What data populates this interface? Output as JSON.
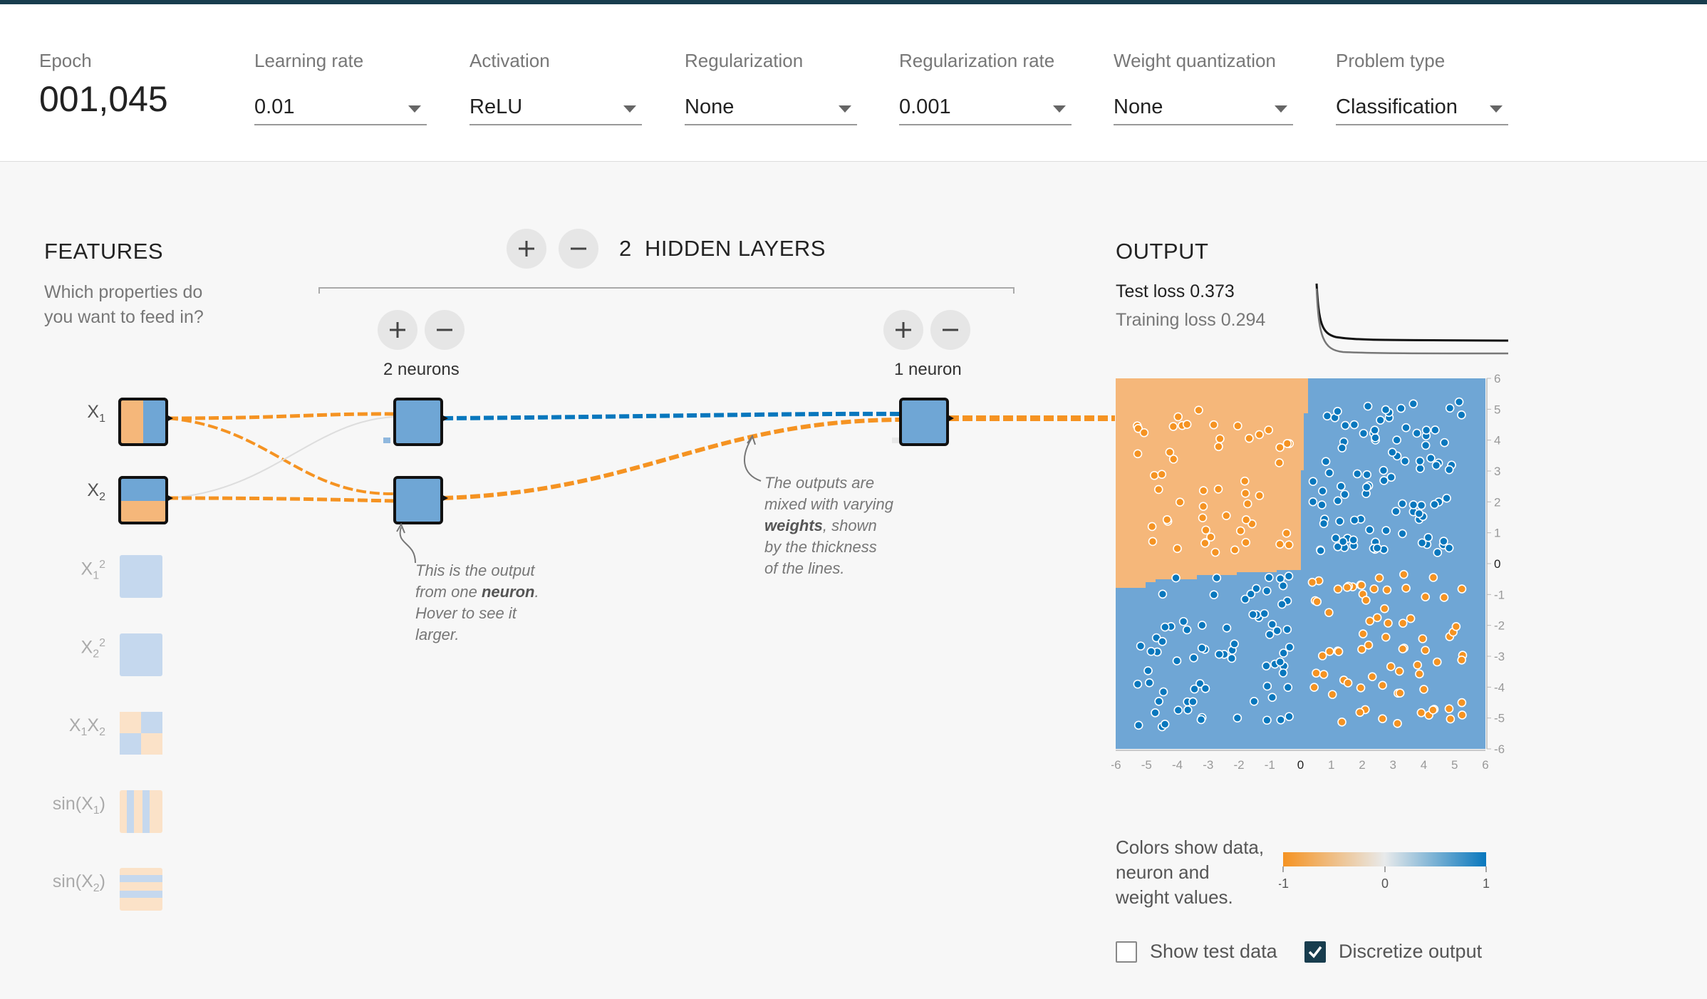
{
  "header": {
    "epoch_label": "Epoch",
    "epoch_value": "001,045",
    "learning_rate": {
      "label": "Learning rate",
      "value": "0.01"
    },
    "activation": {
      "label": "Activation",
      "value": "ReLU"
    },
    "regularization": {
      "label": "Regularization",
      "value": "None"
    },
    "regularization_rate": {
      "label": "Regularization rate",
      "value": "0.001"
    },
    "weight_quantization": {
      "label": "Weight quantization",
      "value": "None"
    },
    "problem_type": {
      "label": "Problem type",
      "value": "Classification"
    }
  },
  "features": {
    "title": "FEATURES",
    "subtitle_line1": "Which properties do",
    "subtitle_line2": "you want to feed in?",
    "items": [
      {
        "base": "X",
        "sub": "1",
        "sup": "",
        "tail": "",
        "active": true
      },
      {
        "base": "X",
        "sub": "2",
        "sup": "",
        "tail": "",
        "active": true
      },
      {
        "base": "X",
        "sub": "1",
        "sup": "2",
        "tail": "",
        "active": false
      },
      {
        "base": "X",
        "sub": "2",
        "sup": "2",
        "tail": "",
        "active": false
      },
      {
        "base": "X",
        "sub": "1",
        "sup": "",
        "tail": "X2",
        "active": false
      },
      {
        "base": "sin(X",
        "sub": "1",
        "sup": "",
        "tail": ")",
        "active": false
      },
      {
        "base": "sin(X",
        "sub": "2",
        "sup": "",
        "tail": ")",
        "active": false
      }
    ]
  },
  "network": {
    "layer_count": "2",
    "title": "HIDDEN LAYERS",
    "layer1_neurons": "2 neurons",
    "layer2_neurons": "1 neuron",
    "note1": [
      "This is the output",
      "from one ",
      "neuron",
      ".",
      "Hover to see it",
      "larger."
    ],
    "note2": [
      "The outputs are",
      "mixed with varying",
      "weights",
      ", shown",
      "by the thickness",
      "of the lines."
    ]
  },
  "output": {
    "title": "OUTPUT",
    "test_loss_label": "Test loss 0.373",
    "training_loss_label": "Training loss 0.294",
    "axis_ticks": [
      "-6",
      "-5",
      "-4",
      "-3",
      "-2",
      "-1",
      "0",
      "1",
      "2",
      "3",
      "4",
      "5",
      "6"
    ],
    "legend_note": [
      "Colors show data,",
      "neuron and",
      "weight values."
    ],
    "legend_ticks": [
      "-1",
      "0",
      "1"
    ],
    "show_test_data": {
      "label": "Show test data",
      "checked": false
    },
    "discretize_output": {
      "label": "Discretize output",
      "checked": true
    }
  },
  "colors": {
    "orange": "#f59322",
    "blue": "#0877bd",
    "orange_light": "#f5b77a",
    "blue_light": "#6fa6d5"
  }
}
